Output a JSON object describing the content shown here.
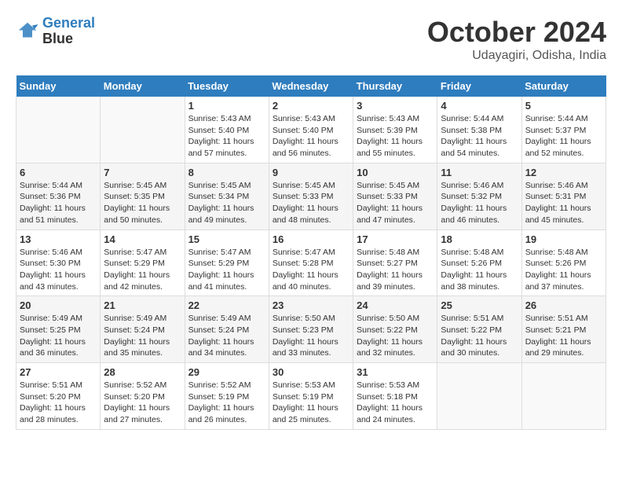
{
  "header": {
    "logo_line1": "General",
    "logo_line2": "Blue",
    "month": "October 2024",
    "location": "Udayagiri, Odisha, India"
  },
  "days_of_week": [
    "Sunday",
    "Monday",
    "Tuesday",
    "Wednesday",
    "Thursday",
    "Friday",
    "Saturday"
  ],
  "weeks": [
    [
      {
        "day": "",
        "sunrise": "",
        "sunset": "",
        "daylight": ""
      },
      {
        "day": "",
        "sunrise": "",
        "sunset": "",
        "daylight": ""
      },
      {
        "day": "1",
        "sunrise": "Sunrise: 5:43 AM",
        "sunset": "Sunset: 5:40 PM",
        "daylight": "Daylight: 11 hours and 57 minutes."
      },
      {
        "day": "2",
        "sunrise": "Sunrise: 5:43 AM",
        "sunset": "Sunset: 5:40 PM",
        "daylight": "Daylight: 11 hours and 56 minutes."
      },
      {
        "day": "3",
        "sunrise": "Sunrise: 5:43 AM",
        "sunset": "Sunset: 5:39 PM",
        "daylight": "Daylight: 11 hours and 55 minutes."
      },
      {
        "day": "4",
        "sunrise": "Sunrise: 5:44 AM",
        "sunset": "Sunset: 5:38 PM",
        "daylight": "Daylight: 11 hours and 54 minutes."
      },
      {
        "day": "5",
        "sunrise": "Sunrise: 5:44 AM",
        "sunset": "Sunset: 5:37 PM",
        "daylight": "Daylight: 11 hours and 52 minutes."
      }
    ],
    [
      {
        "day": "6",
        "sunrise": "Sunrise: 5:44 AM",
        "sunset": "Sunset: 5:36 PM",
        "daylight": "Daylight: 11 hours and 51 minutes."
      },
      {
        "day": "7",
        "sunrise": "Sunrise: 5:45 AM",
        "sunset": "Sunset: 5:35 PM",
        "daylight": "Daylight: 11 hours and 50 minutes."
      },
      {
        "day": "8",
        "sunrise": "Sunrise: 5:45 AM",
        "sunset": "Sunset: 5:34 PM",
        "daylight": "Daylight: 11 hours and 49 minutes."
      },
      {
        "day": "9",
        "sunrise": "Sunrise: 5:45 AM",
        "sunset": "Sunset: 5:33 PM",
        "daylight": "Daylight: 11 hours and 48 minutes."
      },
      {
        "day": "10",
        "sunrise": "Sunrise: 5:45 AM",
        "sunset": "Sunset: 5:33 PM",
        "daylight": "Daylight: 11 hours and 47 minutes."
      },
      {
        "day": "11",
        "sunrise": "Sunrise: 5:46 AM",
        "sunset": "Sunset: 5:32 PM",
        "daylight": "Daylight: 11 hours and 46 minutes."
      },
      {
        "day": "12",
        "sunrise": "Sunrise: 5:46 AM",
        "sunset": "Sunset: 5:31 PM",
        "daylight": "Daylight: 11 hours and 45 minutes."
      }
    ],
    [
      {
        "day": "13",
        "sunrise": "Sunrise: 5:46 AM",
        "sunset": "Sunset: 5:30 PM",
        "daylight": "Daylight: 11 hours and 43 minutes."
      },
      {
        "day": "14",
        "sunrise": "Sunrise: 5:47 AM",
        "sunset": "Sunset: 5:29 PM",
        "daylight": "Daylight: 11 hours and 42 minutes."
      },
      {
        "day": "15",
        "sunrise": "Sunrise: 5:47 AM",
        "sunset": "Sunset: 5:29 PM",
        "daylight": "Daylight: 11 hours and 41 minutes."
      },
      {
        "day": "16",
        "sunrise": "Sunrise: 5:47 AM",
        "sunset": "Sunset: 5:28 PM",
        "daylight": "Daylight: 11 hours and 40 minutes."
      },
      {
        "day": "17",
        "sunrise": "Sunrise: 5:48 AM",
        "sunset": "Sunset: 5:27 PM",
        "daylight": "Daylight: 11 hours and 39 minutes."
      },
      {
        "day": "18",
        "sunrise": "Sunrise: 5:48 AM",
        "sunset": "Sunset: 5:26 PM",
        "daylight": "Daylight: 11 hours and 38 minutes."
      },
      {
        "day": "19",
        "sunrise": "Sunrise: 5:48 AM",
        "sunset": "Sunset: 5:26 PM",
        "daylight": "Daylight: 11 hours and 37 minutes."
      }
    ],
    [
      {
        "day": "20",
        "sunrise": "Sunrise: 5:49 AM",
        "sunset": "Sunset: 5:25 PM",
        "daylight": "Daylight: 11 hours and 36 minutes."
      },
      {
        "day": "21",
        "sunrise": "Sunrise: 5:49 AM",
        "sunset": "Sunset: 5:24 PM",
        "daylight": "Daylight: 11 hours and 35 minutes."
      },
      {
        "day": "22",
        "sunrise": "Sunrise: 5:49 AM",
        "sunset": "Sunset: 5:24 PM",
        "daylight": "Daylight: 11 hours and 34 minutes."
      },
      {
        "day": "23",
        "sunrise": "Sunrise: 5:50 AM",
        "sunset": "Sunset: 5:23 PM",
        "daylight": "Daylight: 11 hours and 33 minutes."
      },
      {
        "day": "24",
        "sunrise": "Sunrise: 5:50 AM",
        "sunset": "Sunset: 5:22 PM",
        "daylight": "Daylight: 11 hours and 32 minutes."
      },
      {
        "day": "25",
        "sunrise": "Sunrise: 5:51 AM",
        "sunset": "Sunset: 5:22 PM",
        "daylight": "Daylight: 11 hours and 30 minutes."
      },
      {
        "day": "26",
        "sunrise": "Sunrise: 5:51 AM",
        "sunset": "Sunset: 5:21 PM",
        "daylight": "Daylight: 11 hours and 29 minutes."
      }
    ],
    [
      {
        "day": "27",
        "sunrise": "Sunrise: 5:51 AM",
        "sunset": "Sunset: 5:20 PM",
        "daylight": "Daylight: 11 hours and 28 minutes."
      },
      {
        "day": "28",
        "sunrise": "Sunrise: 5:52 AM",
        "sunset": "Sunset: 5:20 PM",
        "daylight": "Daylight: 11 hours and 27 minutes."
      },
      {
        "day": "29",
        "sunrise": "Sunrise: 5:52 AM",
        "sunset": "Sunset: 5:19 PM",
        "daylight": "Daylight: 11 hours and 26 minutes."
      },
      {
        "day": "30",
        "sunrise": "Sunrise: 5:53 AM",
        "sunset": "Sunset: 5:19 PM",
        "daylight": "Daylight: 11 hours and 25 minutes."
      },
      {
        "day": "31",
        "sunrise": "Sunrise: 5:53 AM",
        "sunset": "Sunset: 5:18 PM",
        "daylight": "Daylight: 11 hours and 24 minutes."
      },
      {
        "day": "",
        "sunrise": "",
        "sunset": "",
        "daylight": ""
      },
      {
        "day": "",
        "sunrise": "",
        "sunset": "",
        "daylight": ""
      }
    ]
  ]
}
